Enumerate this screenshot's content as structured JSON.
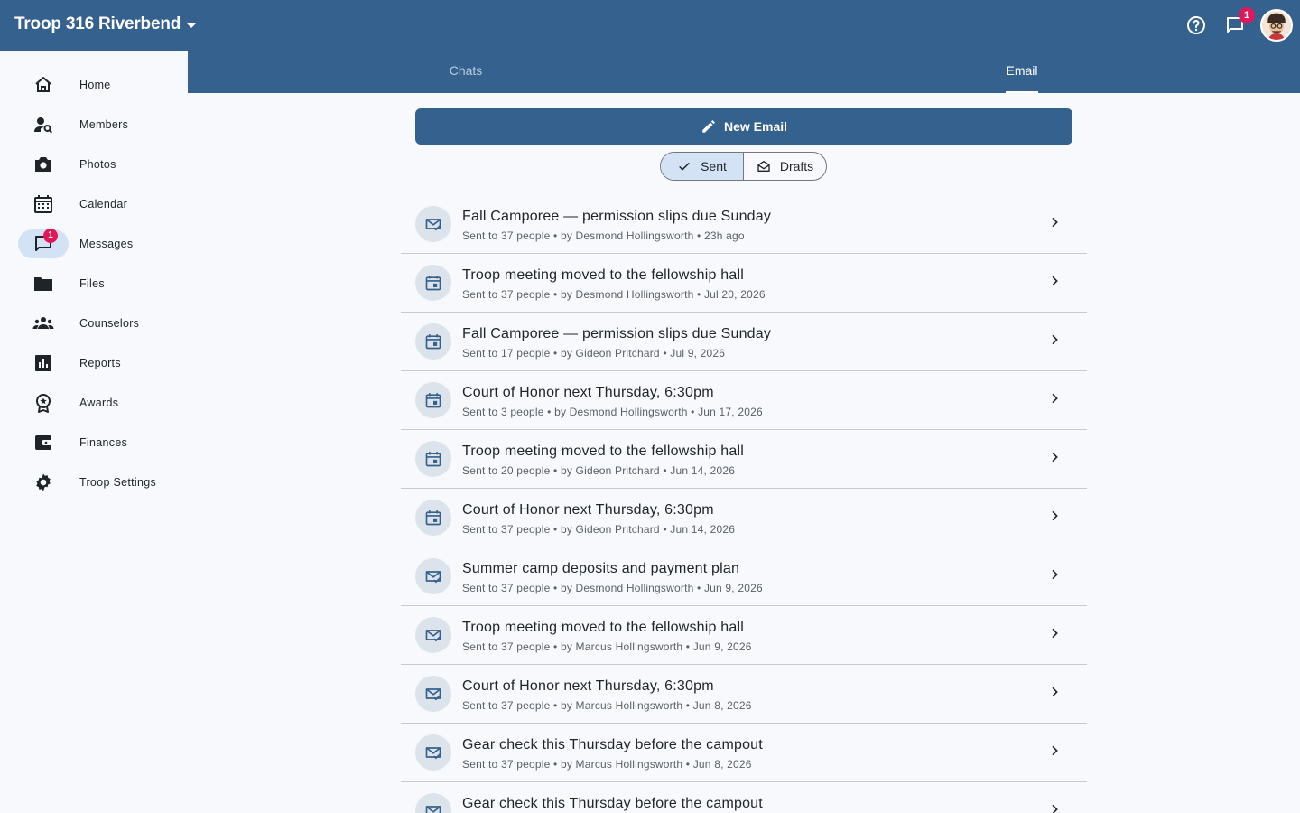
{
  "header": {
    "troop_name": "Troop 316 Riverbend",
    "messages_badge": "1"
  },
  "tabs": [
    {
      "label": "Chats",
      "active": false
    },
    {
      "label": "Email",
      "active": true
    }
  ],
  "sidebar": {
    "items": [
      {
        "label": "Home",
        "icon": "home-icon"
      },
      {
        "label": "Members",
        "icon": "person-search-icon"
      },
      {
        "label": "Photos",
        "icon": "camera-icon"
      },
      {
        "label": "Calendar",
        "icon": "calendar-icon"
      },
      {
        "label": "Messages",
        "icon": "chat-icon",
        "badge": "1",
        "active": true
      },
      {
        "label": "Files",
        "icon": "folder-icon"
      },
      {
        "label": "Counselors",
        "icon": "groups-icon"
      },
      {
        "label": "Reports",
        "icon": "bar-chart-icon"
      },
      {
        "label": "Awards",
        "icon": "award-icon"
      },
      {
        "label": "Finances",
        "icon": "wallet-icon"
      },
      {
        "label": "Troop Settings",
        "icon": "gear-icon"
      }
    ]
  },
  "compose": {
    "label": "New Email"
  },
  "filter": {
    "sent_label": "Sent",
    "drafts_label": "Drafts",
    "selected": "Sent"
  },
  "emails": [
    {
      "title": "Fall Camporee — permission slips due Sunday",
      "meta": "Sent to 37 people • by Desmond Hollingsworth • 23h ago",
      "icon": "mail-check-icon"
    },
    {
      "title": "Troop meeting moved to the fellowship hall",
      "meta": "Sent to 37 people • by Desmond Hollingsworth • Jul 20, 2026",
      "icon": "calendar-event-icon"
    },
    {
      "title": "Fall Camporee — permission slips due Sunday",
      "meta": "Sent to 17 people • by Gideon Pritchard • Jul 9, 2026",
      "icon": "calendar-event-icon"
    },
    {
      "title": "Court of Honor next Thursday, 6:30pm",
      "meta": "Sent to 3 people • by Desmond Hollingsworth • Jun 17, 2026",
      "icon": "calendar-event-icon"
    },
    {
      "title": "Troop meeting moved to the fellowship hall",
      "meta": "Sent to 20 people • by Gideon Pritchard • Jun 14, 2026",
      "icon": "calendar-event-icon"
    },
    {
      "title": "Court of Honor next Thursday, 6:30pm",
      "meta": "Sent to 37 people • by Gideon Pritchard • Jun 14, 2026",
      "icon": "calendar-event-icon"
    },
    {
      "title": "Summer camp deposits and payment plan",
      "meta": "Sent to 37 people • by Desmond Hollingsworth • Jun 9, 2026",
      "icon": "mail-check-icon"
    },
    {
      "title": "Troop meeting moved to the fellowship hall",
      "meta": "Sent to 37 people • by Marcus Hollingsworth • Jun 9, 2026",
      "icon": "mail-check-icon"
    },
    {
      "title": "Court of Honor next Thursday, 6:30pm",
      "meta": "Sent to 37 people • by Marcus Hollingsworth • Jun 8, 2026",
      "icon": "mail-check-icon"
    },
    {
      "title": "Gear check this Thursday before the campout",
      "meta": "Sent to 37 people • by Marcus Hollingsworth • Jun 8, 2026",
      "icon": "mail-check-icon"
    },
    {
      "title": "Gear check this Thursday before the campout",
      "meta": "",
      "icon": "mail-check-icon"
    }
  ],
  "colors": {
    "primary": "#35618f",
    "badge": "#e0185a",
    "selected": "#d3e3f5",
    "background": "#f7f9fc"
  }
}
